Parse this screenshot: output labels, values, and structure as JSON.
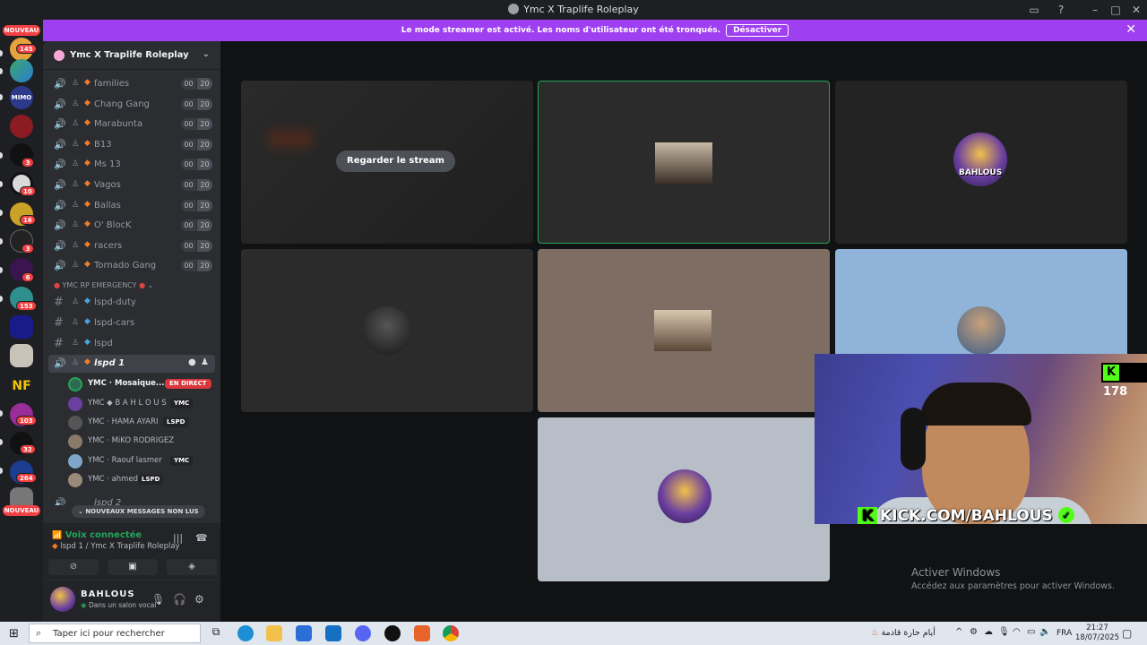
{
  "window": {
    "title": "Ymc X Traplife Roleplay"
  },
  "banner": {
    "message": "Le mode streamer est activé. Les noms d'utilisateur ont été tronqués.",
    "button_label": "Désactiver"
  },
  "rail": {
    "badges": [
      "145",
      "3",
      "10",
      "16",
      "3",
      "6",
      "153",
      "103",
      "32",
      "264"
    ],
    "new_label": "NOUVEAU",
    "server_labels": [
      "MIMO",
      "NF"
    ]
  },
  "server": {
    "name": "Ymc X Traplife Roleplay"
  },
  "channels": [
    {
      "label": "families",
      "a": "00",
      "b": "20"
    },
    {
      "label": "Chang Gang",
      "a": "00",
      "b": "20"
    },
    {
      "label": "Marabunta",
      "a": "00",
      "b": "20"
    },
    {
      "label": "B13",
      "a": "00",
      "b": "20"
    },
    {
      "label": "Ms 13",
      "a": "00",
      "b": "20"
    },
    {
      "label": "Vagos",
      "a": "00",
      "b": "20"
    },
    {
      "label": "Ballas",
      "a": "00",
      "b": "20"
    },
    {
      "label": "O' BlocK",
      "a": "00",
      "b": "20"
    },
    {
      "label": "racers",
      "a": "00",
      "b": "20"
    },
    {
      "label": "Tornado Gang",
      "a": "00",
      "b": "20"
    }
  ],
  "category": {
    "label": "YMC RP EMERGENCY"
  },
  "text_channels": [
    "lspd-duty",
    "lspd-cars",
    "lspd"
  ],
  "active_voice": {
    "label": "lspd 1"
  },
  "voice_users": [
    {
      "name": "YMC · Mosaique...",
      "tag": "EN DIRECT"
    },
    {
      "name": "YMC ◆ B A H L O U S",
      "tag": "YMC"
    },
    {
      "name": "YMC · HAMA AYARI",
      "tag": "LSPD"
    },
    {
      "name": "YMC · MiKO RODRIGEZ",
      "tag": ""
    },
    {
      "name": "YMC · Raouf lasmer",
      "tag": "YMC"
    },
    {
      "name": "YMC · ahmed",
      "tag": "LSPD"
    }
  ],
  "next_channel": "lspd 2",
  "new_messages": "NOUVEAUX MESSAGES NON LUS",
  "voice_panel": {
    "status": "Voix connectée",
    "channel": "lspd 1 / Ymc X Traplife Roleplay"
  },
  "user": {
    "name": "BAHLOUS",
    "status": "Dans un salon vocal"
  },
  "stage": {
    "watch_label": "Regarder le stream"
  },
  "watermark": {
    "line1": "Activer Windows",
    "line2": "Accédez aux paramètres pour activer Windows."
  },
  "webcam": {
    "viewer_count": "178",
    "url": "KICK.COM/BAHLOUS",
    "avatar_name": "BAHLOUS"
  },
  "taskbar": {
    "search_placeholder": "Taper ici pour rechercher",
    "weather": "أيام حارة قادمة",
    "lang": "FRA",
    "time": "21:27",
    "date": "18/07/2025"
  },
  "colors": {
    "banner": "#9f3ff2",
    "speaking": "#23a55a",
    "live": "#da373c",
    "kick_green": "#53fc18"
  }
}
